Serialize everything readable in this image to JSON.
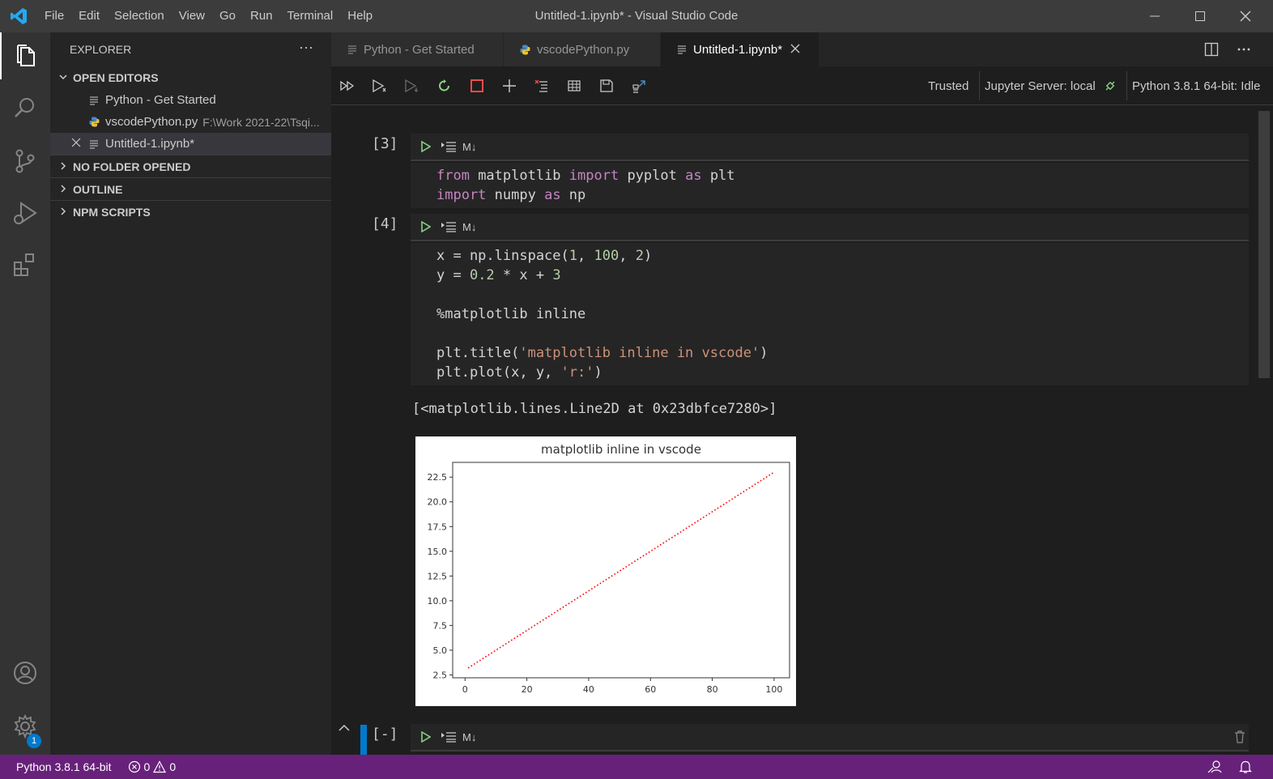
{
  "window": {
    "title": "Untitled-1.ipynb* - Visual Studio Code",
    "menu": [
      "File",
      "Edit",
      "Selection",
      "View",
      "Go",
      "Run",
      "Terminal",
      "Help"
    ]
  },
  "sidebar": {
    "title": "EXPLORER",
    "more": "···",
    "sections": {
      "open_editors": "OPEN EDITORS",
      "no_folder": "NO FOLDER OPENED",
      "outline": "OUTLINE",
      "npm": "NPM SCRIPTS"
    },
    "open_editors": [
      {
        "name": "Python - Get Started",
        "path": "",
        "icon": "preview-icon"
      },
      {
        "name": "vscodePython.py",
        "path": "F:\\Work 2021-22\\Tsqi...",
        "icon": "python-icon"
      },
      {
        "name": "Untitled-1.ipynb*",
        "path": "",
        "icon": "notebook-icon"
      }
    ]
  },
  "tabs": [
    {
      "label": "Python - Get Started",
      "icon": "preview-icon"
    },
    {
      "label": "vscodePython.py",
      "icon": "python-icon"
    },
    {
      "label": "Untitled-1.ipynb*",
      "icon": "notebook-icon",
      "active": true
    }
  ],
  "toolbar": {
    "trusted": "Trusted",
    "jupyter_server": "Jupyter Server: local",
    "kernel": "Python 3.8.1 64-bit: Idle"
  },
  "cells": {
    "cell3_count": "[3]",
    "cell4_count": "[4]",
    "cell5_count": "[-]",
    "md_label": "M↓",
    "output_text": "[<matplotlib.lines.Line2D at 0x23dbfce7280>]"
  },
  "chart_data": {
    "type": "line",
    "title": "matplotlib inline in vscode",
    "xlabel": "",
    "ylabel": "",
    "x": [
      1,
      100
    ],
    "y": [
      3.2,
      23.0
    ],
    "style": "r:",
    "color": "#ff0000",
    "xlim": [
      -4.0,
      105.0
    ],
    "ylim": [
      2.21,
      23.99
    ],
    "xticks": [
      "0",
      "20",
      "40",
      "60",
      "80",
      "100"
    ],
    "xtick_values": [
      0,
      20,
      40,
      60,
      80,
      100
    ],
    "yticks": [
      "2.5",
      "5.0",
      "7.5",
      "10.0",
      "12.5",
      "15.0",
      "17.5",
      "20.0",
      "22.5"
    ],
    "ytick_values": [
      2.5,
      5.0,
      7.5,
      10.0,
      12.5,
      15.0,
      17.5,
      20.0,
      22.5
    ],
    "grid": false
  },
  "statusbar": {
    "interpreter": "Python 3.8.1 64-bit",
    "errors": "0",
    "warnings": "0",
    "settings_badge": "1"
  },
  "colors": {
    "accent": "#007acc",
    "statusbar": "#68217a",
    "run_green": "#89d185",
    "restart_green": "#89d185",
    "interrupt_red": "#f14c4c"
  }
}
